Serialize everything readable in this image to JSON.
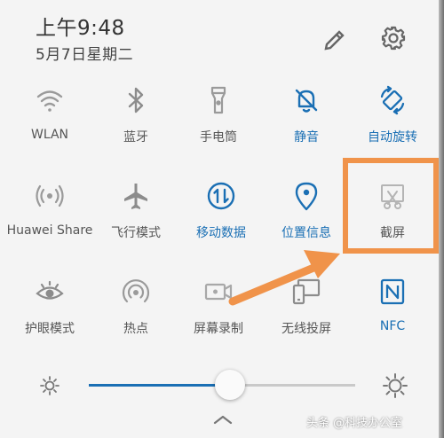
{
  "header": {
    "time": "上午9:48",
    "date": "5月7日星期二"
  },
  "colors": {
    "active": "#1a6fb4",
    "inactive": "#999999",
    "highlight": "#f0934a"
  },
  "tiles": [
    {
      "label": "WLAN",
      "icon": "wifi-icon",
      "active": false
    },
    {
      "label": "蓝牙",
      "icon": "bluetooth-icon",
      "active": false
    },
    {
      "label": "手电筒",
      "icon": "flashlight-icon",
      "active": false
    },
    {
      "label": "静音",
      "icon": "bell-off-icon",
      "active": true
    },
    {
      "label": "自动旋转",
      "icon": "auto-rotate-icon",
      "active": true
    },
    {
      "label": "Huawei Share",
      "icon": "huawei-share-icon",
      "active": false
    },
    {
      "label": "飞行模式",
      "icon": "airplane-icon",
      "active": false
    },
    {
      "label": "移动数据",
      "icon": "mobile-data-icon",
      "active": true
    },
    {
      "label": "位置信息",
      "icon": "location-icon",
      "active": true
    },
    {
      "label": "截屏",
      "icon": "screenshot-icon",
      "active": false
    },
    {
      "label": "护眼模式",
      "icon": "eye-icon",
      "active": false
    },
    {
      "label": "热点",
      "icon": "hotspot-icon",
      "active": false
    },
    {
      "label": "屏幕录制",
      "icon": "screen-record-icon",
      "active": false
    },
    {
      "label": "无线投屏",
      "icon": "wireless-projection-icon",
      "active": false
    },
    {
      "label": "NFC",
      "icon": "nfc-icon",
      "active": true
    }
  ],
  "brightness": {
    "level": 0.53
  },
  "watermark": "头条 @科技办公室"
}
